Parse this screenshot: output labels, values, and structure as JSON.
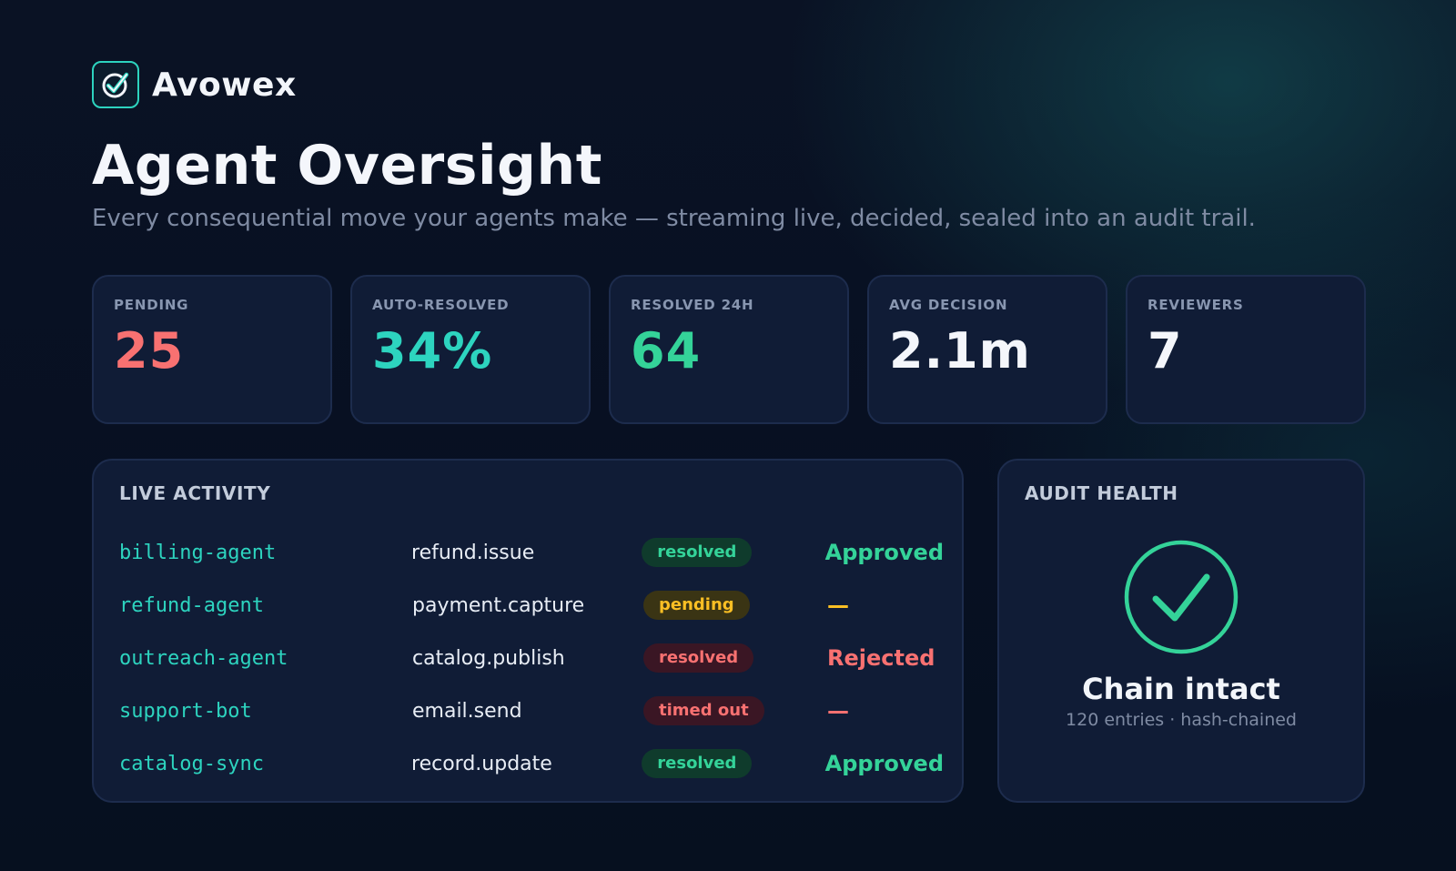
{
  "brand": {
    "name": "Avowex",
    "logo_icon": "check-badge-icon",
    "accent": "#2dd4bf"
  },
  "header": {
    "title": "Agent Oversight",
    "subtitle": "Every consequential move your agents make — streaming live, decided, sealed into an audit trail."
  },
  "stats": [
    {
      "label": "PENDING",
      "value": "25",
      "color": "#f87171"
    },
    {
      "label": "AUTO-RESOLVED",
      "value": "34%",
      "color": "#2dd4bf"
    },
    {
      "label": "RESOLVED 24H",
      "value": "64",
      "color": "#34d399"
    },
    {
      "label": "AVG DECISION",
      "value": "2.1m",
      "color": "#f4f6fb"
    },
    {
      "label": "REVIEWERS",
      "value": "7",
      "color": "#f4f6fb"
    }
  ],
  "activity": {
    "title": "LIVE ACTIVITY",
    "rows": [
      {
        "agent": "billing-agent",
        "action": "refund.issue",
        "status": "resolved",
        "outcome": "Approved",
        "outcome_color": "#34d399"
      },
      {
        "agent": "refund-agent",
        "action": "payment.capture",
        "status": "pending",
        "outcome": "—",
        "outcome_color": "#fbbf24"
      },
      {
        "agent": "outreach-agent",
        "action": "catalog.publish",
        "status": "resolved",
        "outcome": "Rejected",
        "outcome_color": "#f87171"
      },
      {
        "agent": "support-bot",
        "action": "email.send",
        "status": "timed out",
        "outcome": "—",
        "outcome_color": "#f87171"
      },
      {
        "agent": "catalog-sync",
        "action": "record.update",
        "status": "resolved",
        "outcome": "Approved",
        "outcome_color": "#34d399"
      }
    ]
  },
  "audit": {
    "title": "AUDIT HEALTH",
    "icon": "check-circle-icon",
    "status": "Chain intact",
    "detail": "120 entries · hash-chained",
    "color": "#34d399"
  }
}
